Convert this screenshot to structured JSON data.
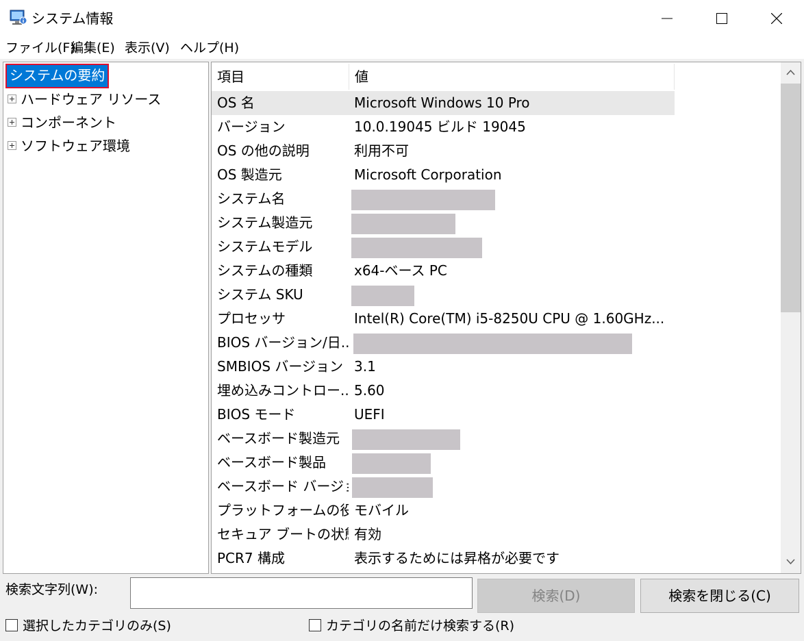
{
  "window": {
    "title": "システム情報"
  },
  "menu": [
    {
      "label": "ファイル(F)"
    },
    {
      "label": "編集(E)"
    },
    {
      "label": "表示(V)"
    },
    {
      "label": "ヘルプ(H)"
    }
  ],
  "tree": {
    "selected": "システムの要約",
    "children": [
      {
        "label": "ハードウェア リソース"
      },
      {
        "label": "コンポーネント"
      },
      {
        "label": "ソフトウェア環境"
      }
    ]
  },
  "table": {
    "headers": {
      "item": "項目",
      "value": "値"
    },
    "rows": [
      {
        "item": "OS 名",
        "value": "Microsoft Windows 10 Pro"
      },
      {
        "item": "バージョン",
        "value": "10.0.19045 ビルド 19045"
      },
      {
        "item": "OS の他の説明",
        "value": "利用不可"
      },
      {
        "item": "OS 製造元",
        "value": "Microsoft Corporation"
      },
      {
        "item": "システム名",
        "value": ""
      },
      {
        "item": "システム製造元",
        "value": ""
      },
      {
        "item": "システムモデル",
        "value": ""
      },
      {
        "item": "システムの種類",
        "value": "x64-ベース PC"
      },
      {
        "item": "システム SKU",
        "value": ""
      },
      {
        "item": "プロセッサ",
        "value": "Intel(R) Core(TM) i5-8250U CPU @ 1.60GHz..."
      },
      {
        "item": "BIOS バージョン/日...",
        "value": ""
      },
      {
        "item": "SMBIOS バージョン",
        "value": "3.1"
      },
      {
        "item": "埋め込みコントロー...",
        "value": "5.60"
      },
      {
        "item": "BIOS モード",
        "value": "UEFI"
      },
      {
        "item": "ベースボード製造元",
        "value": ""
      },
      {
        "item": "ベースボード製品",
        "value": ""
      },
      {
        "item": "ベースボード バージョン",
        "value": ""
      },
      {
        "item": "プラットフォームの役...",
        "value": "モバイル"
      },
      {
        "item": "セキュア ブートの状態",
        "value": "有効"
      },
      {
        "item": "PCR7 構成",
        "value": "表示するためには昇格が必要です"
      }
    ]
  },
  "search": {
    "label": "検索文字列(W):",
    "value": "",
    "search_button": "検索(D)",
    "close_button": "検索を閉じる(C)",
    "selected_category_only": "選択したカテゴリのみ(S)",
    "category_names_only": "カテゴリの名前だけ検索する(R)"
  },
  "colors": {
    "selection": "#0078d7",
    "selection_outline": "#e0102e",
    "redaction": "#c8c4c8"
  }
}
